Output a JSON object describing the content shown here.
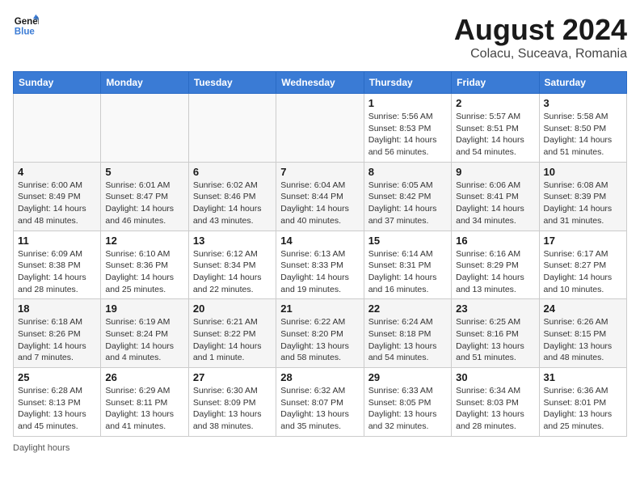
{
  "header": {
    "logo_line1": "General",
    "logo_line2": "Blue",
    "month_year": "August 2024",
    "location": "Colacu, Suceava, Romania"
  },
  "days_of_week": [
    "Sunday",
    "Monday",
    "Tuesday",
    "Wednesday",
    "Thursday",
    "Friday",
    "Saturday"
  ],
  "weeks": [
    [
      {
        "day": "",
        "info": ""
      },
      {
        "day": "",
        "info": ""
      },
      {
        "day": "",
        "info": ""
      },
      {
        "day": "",
        "info": ""
      },
      {
        "day": "1",
        "info": "Sunrise: 5:56 AM\nSunset: 8:53 PM\nDaylight: 14 hours and 56 minutes."
      },
      {
        "day": "2",
        "info": "Sunrise: 5:57 AM\nSunset: 8:51 PM\nDaylight: 14 hours and 54 minutes."
      },
      {
        "day": "3",
        "info": "Sunrise: 5:58 AM\nSunset: 8:50 PM\nDaylight: 14 hours and 51 minutes."
      }
    ],
    [
      {
        "day": "4",
        "info": "Sunrise: 6:00 AM\nSunset: 8:49 PM\nDaylight: 14 hours and 48 minutes."
      },
      {
        "day": "5",
        "info": "Sunrise: 6:01 AM\nSunset: 8:47 PM\nDaylight: 14 hours and 46 minutes."
      },
      {
        "day": "6",
        "info": "Sunrise: 6:02 AM\nSunset: 8:46 PM\nDaylight: 14 hours and 43 minutes."
      },
      {
        "day": "7",
        "info": "Sunrise: 6:04 AM\nSunset: 8:44 PM\nDaylight: 14 hours and 40 minutes."
      },
      {
        "day": "8",
        "info": "Sunrise: 6:05 AM\nSunset: 8:42 PM\nDaylight: 14 hours and 37 minutes."
      },
      {
        "day": "9",
        "info": "Sunrise: 6:06 AM\nSunset: 8:41 PM\nDaylight: 14 hours and 34 minutes."
      },
      {
        "day": "10",
        "info": "Sunrise: 6:08 AM\nSunset: 8:39 PM\nDaylight: 14 hours and 31 minutes."
      }
    ],
    [
      {
        "day": "11",
        "info": "Sunrise: 6:09 AM\nSunset: 8:38 PM\nDaylight: 14 hours and 28 minutes."
      },
      {
        "day": "12",
        "info": "Sunrise: 6:10 AM\nSunset: 8:36 PM\nDaylight: 14 hours and 25 minutes."
      },
      {
        "day": "13",
        "info": "Sunrise: 6:12 AM\nSunset: 8:34 PM\nDaylight: 14 hours and 22 minutes."
      },
      {
        "day": "14",
        "info": "Sunrise: 6:13 AM\nSunset: 8:33 PM\nDaylight: 14 hours and 19 minutes."
      },
      {
        "day": "15",
        "info": "Sunrise: 6:14 AM\nSunset: 8:31 PM\nDaylight: 14 hours and 16 minutes."
      },
      {
        "day": "16",
        "info": "Sunrise: 6:16 AM\nSunset: 8:29 PM\nDaylight: 14 hours and 13 minutes."
      },
      {
        "day": "17",
        "info": "Sunrise: 6:17 AM\nSunset: 8:27 PM\nDaylight: 14 hours and 10 minutes."
      }
    ],
    [
      {
        "day": "18",
        "info": "Sunrise: 6:18 AM\nSunset: 8:26 PM\nDaylight: 14 hours and 7 minutes."
      },
      {
        "day": "19",
        "info": "Sunrise: 6:19 AM\nSunset: 8:24 PM\nDaylight: 14 hours and 4 minutes."
      },
      {
        "day": "20",
        "info": "Sunrise: 6:21 AM\nSunset: 8:22 PM\nDaylight: 14 hours and 1 minute."
      },
      {
        "day": "21",
        "info": "Sunrise: 6:22 AM\nSunset: 8:20 PM\nDaylight: 13 hours and 58 minutes."
      },
      {
        "day": "22",
        "info": "Sunrise: 6:24 AM\nSunset: 8:18 PM\nDaylight: 13 hours and 54 minutes."
      },
      {
        "day": "23",
        "info": "Sunrise: 6:25 AM\nSunset: 8:16 PM\nDaylight: 13 hours and 51 minutes."
      },
      {
        "day": "24",
        "info": "Sunrise: 6:26 AM\nSunset: 8:15 PM\nDaylight: 13 hours and 48 minutes."
      }
    ],
    [
      {
        "day": "25",
        "info": "Sunrise: 6:28 AM\nSunset: 8:13 PM\nDaylight: 13 hours and 45 minutes."
      },
      {
        "day": "26",
        "info": "Sunrise: 6:29 AM\nSunset: 8:11 PM\nDaylight: 13 hours and 41 minutes."
      },
      {
        "day": "27",
        "info": "Sunrise: 6:30 AM\nSunset: 8:09 PM\nDaylight: 13 hours and 38 minutes."
      },
      {
        "day": "28",
        "info": "Sunrise: 6:32 AM\nSunset: 8:07 PM\nDaylight: 13 hours and 35 minutes."
      },
      {
        "day": "29",
        "info": "Sunrise: 6:33 AM\nSunset: 8:05 PM\nDaylight: 13 hours and 32 minutes."
      },
      {
        "day": "30",
        "info": "Sunrise: 6:34 AM\nSunset: 8:03 PM\nDaylight: 13 hours and 28 minutes."
      },
      {
        "day": "31",
        "info": "Sunrise: 6:36 AM\nSunset: 8:01 PM\nDaylight: 13 hours and 25 minutes."
      }
    ]
  ],
  "footer": {
    "note": "Daylight hours"
  }
}
